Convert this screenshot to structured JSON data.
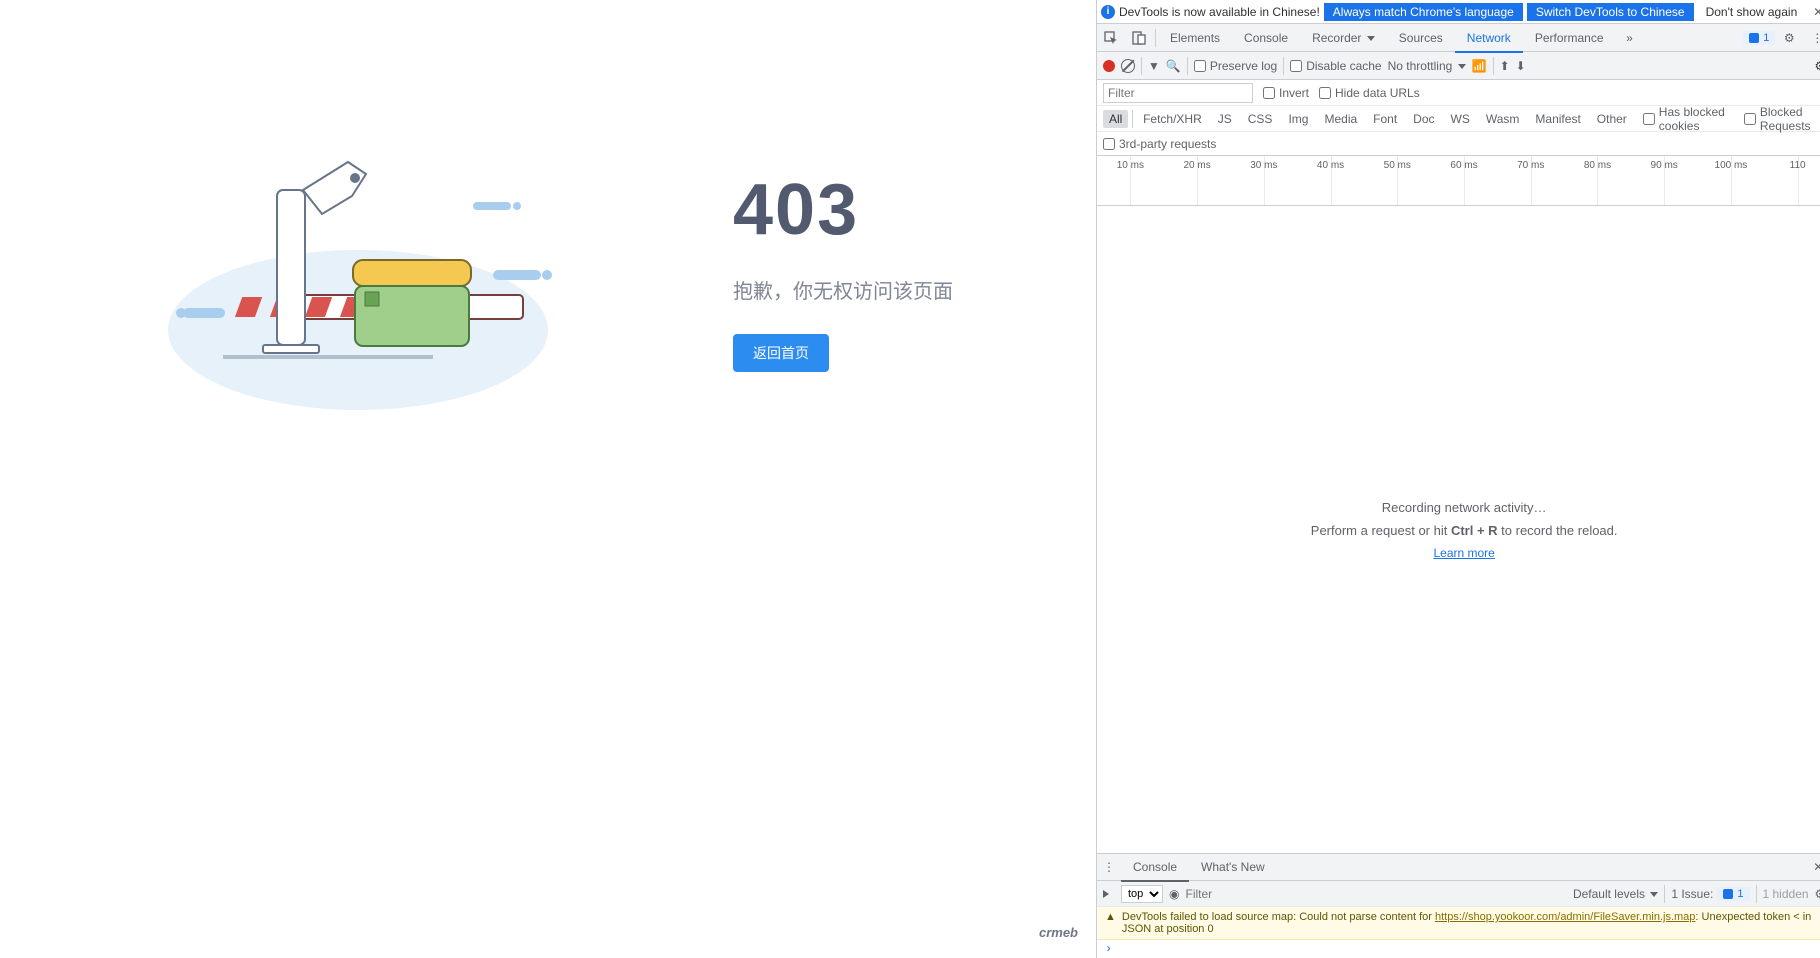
{
  "page": {
    "error_code": "403",
    "error_message": "抱歉，你无权访问该页面",
    "back_button": "返回首页",
    "brand": "crmeb"
  },
  "lang_bar": {
    "msg": "DevTools is now available in Chinese!",
    "match": "Always match Chrome's language",
    "switch": "Switch DevTools to Chinese",
    "dont": "Don't show again"
  },
  "tabs": {
    "elements": "Elements",
    "console": "Console",
    "recorder": "Recorder",
    "sources": "Sources",
    "network": "Network",
    "performance": "Performance",
    "issue_count": "1"
  },
  "net_toolbar": {
    "preserve": "Preserve log",
    "disable_cache": "Disable cache",
    "throttling": "No throttling"
  },
  "filter": {
    "placeholder": "Filter",
    "invert": "Invert",
    "hide_data": "Hide data URLs"
  },
  "types": [
    "All",
    "Fetch/XHR",
    "JS",
    "CSS",
    "Img",
    "Media",
    "Font",
    "Doc",
    "WS",
    "Wasm",
    "Manifest",
    "Other"
  ],
  "types_extra": {
    "blocked_cookies": "Has blocked cookies",
    "blocked_requests": "Blocked Requests"
  },
  "third_party": "3rd-party requests",
  "timeline_ticks": [
    "10 ms",
    "20 ms",
    "30 ms",
    "40 ms",
    "50 ms",
    "60 ms",
    "70 ms",
    "80 ms",
    "90 ms",
    "100 ms",
    "110"
  ],
  "empty": {
    "recording": "Recording network activity…",
    "perform_pre": "Perform a request or hit ",
    "shortcut": "Ctrl + R",
    "perform_post": " to record the reload.",
    "learn": "Learn more"
  },
  "drawer": {
    "console": "Console",
    "whatsnew": "What's New"
  },
  "console_tb": {
    "top": "top",
    "filter": "Filter",
    "levels": "Default levels",
    "issues_label": "1 Issue:",
    "issues_count": "1",
    "hidden": "1 hidden"
  },
  "console_msg": {
    "text_pre": "DevTools failed to load source map: Could not parse content for ",
    "url": "https://shop.yookoor.com/admin/FileSaver.min.js.map",
    "text_post": ": Unexpected token < in JSON at position 0"
  }
}
